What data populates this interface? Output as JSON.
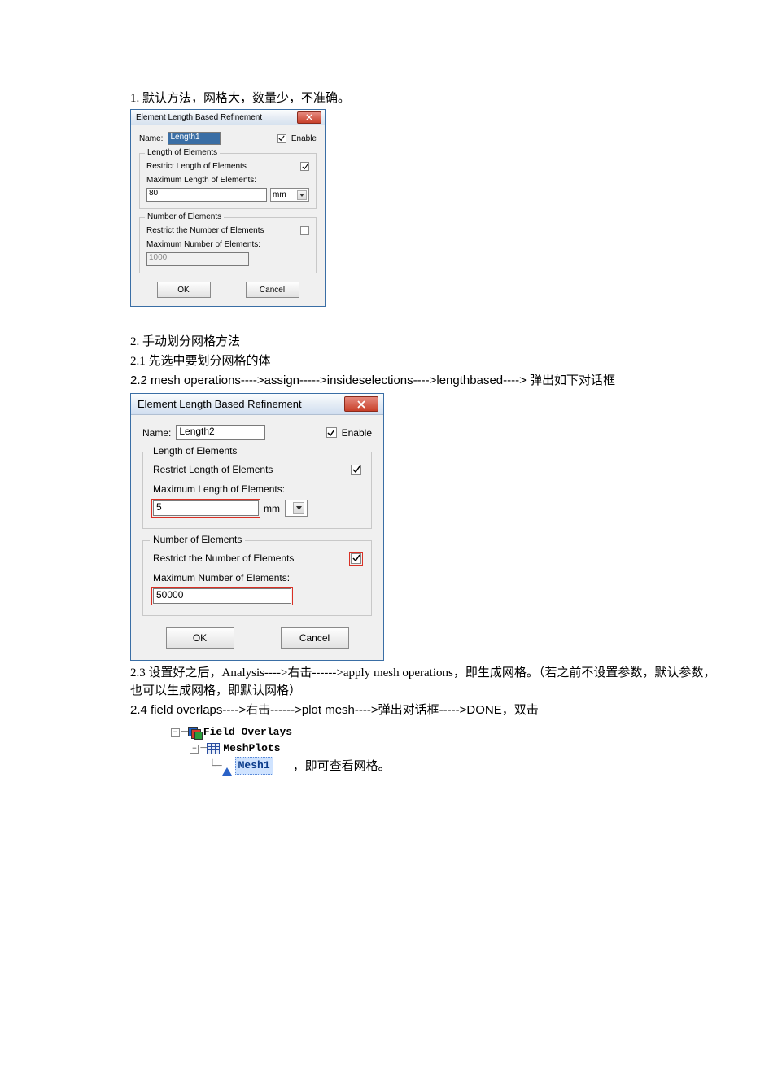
{
  "text": {
    "s1": "1. 默认方法，网格大，数量少，不准确。",
    "s2": "2. 手动划分网格方法",
    "s2_1": "2.1  先选中要划分网格的体",
    "s2_2": "2.2    mesh operations---->assign----->insideselections---->lengthbased----> 弹出如下对话框",
    "s2_3": "2.3  设置好之后，Analysis---->右击------>apply mesh operations，即生成网格。（若之前不设置参数，默认参数，也可以生成网格，即默认网格）",
    "s2_4": "2.4    field overlaps---->右击------>plot mesh---->弹出对话框----->DONE，双击",
    "tree_suffix": "，即可查看网格。"
  },
  "d1": {
    "title": "Element Length Based Refinement",
    "name_label": "Name:",
    "name_value": "Length1",
    "enable_label": "Enable",
    "enable_checked": true,
    "grp_length": "Length of Elements",
    "restrict_len_label": "Restrict Length of Elements",
    "restrict_len_checked": true,
    "maxlen_label": "Maximum Length of Elements:",
    "maxlen_value": "80",
    "maxlen_unit": "mm",
    "grp_number": "Number of Elements",
    "restrict_num_label": "Restrict the Number of Elements",
    "restrict_num_checked": false,
    "maxnum_label": "Maximum Number of  Elements:",
    "maxnum_value": "1000",
    "ok": "OK",
    "cancel": "Cancel"
  },
  "d2": {
    "title": "Element Length Based Refinement",
    "name_label": "Name:",
    "name_value": "Length2",
    "enable_label": "Enable",
    "enable_checked": true,
    "grp_length": "Length of Elements",
    "restrict_len_label": "Restrict Length of Elements",
    "restrict_len_checked": true,
    "maxlen_label": "Maximum Length of Elements:",
    "maxlen_value": "5",
    "maxlen_unit": "mm",
    "grp_number": "Number of Elements",
    "restrict_num_label": "Restrict the Number of Elements",
    "restrict_num_checked": true,
    "maxnum_label": "Maximum Number of  Elements:",
    "maxnum_value": "50000",
    "ok": "OK",
    "cancel": "Cancel"
  },
  "tree": {
    "n1": "Field Overlays",
    "n2": "MeshPlots",
    "n3": "Mesh1"
  }
}
